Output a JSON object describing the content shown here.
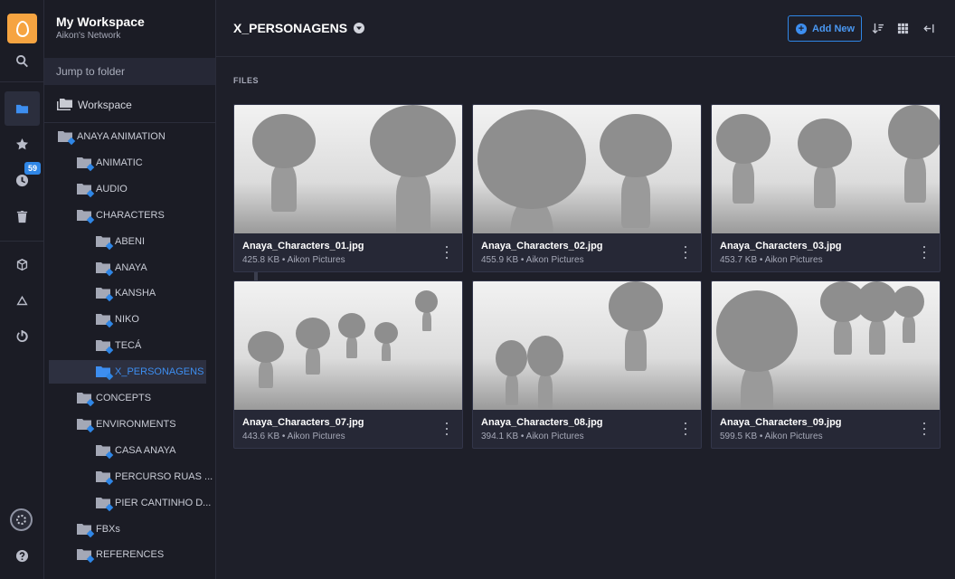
{
  "rail": {
    "badge_count": "59",
    "icons": [
      "logo-icon",
      "search-icon",
      "folder-icon",
      "star-icon",
      "clock-icon",
      "trash-icon",
      "cube-icon",
      "cloud-icon",
      "power-icon",
      "avatar",
      "help-icon"
    ]
  },
  "panel": {
    "title": "My Workspace",
    "subtitle": "Aikon's Network",
    "jump_placeholder": "Jump to folder",
    "workspace_label": "Workspace",
    "tree": [
      {
        "label": "ANAYA ANIMATION",
        "level": 0
      },
      {
        "label": "ANIMATIC",
        "level": 1
      },
      {
        "label": "AUDIO",
        "level": 1
      },
      {
        "label": "CHARACTERS",
        "level": 1
      },
      {
        "label": "ABENI",
        "level": 2
      },
      {
        "label": "ANAYA",
        "level": 2
      },
      {
        "label": "KANSHA",
        "level": 2
      },
      {
        "label": "NIKO",
        "level": 2
      },
      {
        "label": "TECÁ",
        "level": 2
      },
      {
        "label": "X_PERSONAGENS",
        "level": 2,
        "selected": true
      },
      {
        "label": "CONCEPTS",
        "level": 1
      },
      {
        "label": "ENVIRONMENTS",
        "level": 1
      },
      {
        "label": "CASA ANAYA",
        "level": 2
      },
      {
        "label": "PERCURSO RUAS ...",
        "level": 2
      },
      {
        "label": "PIER CANTINHO D...",
        "level": 2
      },
      {
        "label": "FBXs",
        "level": 1
      },
      {
        "label": "REFERENCES",
        "level": 1
      }
    ]
  },
  "header": {
    "title": "X_PERSONAGENS",
    "add_new": "Add New"
  },
  "files_label": "FILES",
  "files": [
    {
      "name": "Anaya_Characters_01.jpg",
      "meta": "425.8 KB • Aikon Pictures"
    },
    {
      "name": "Anaya_Characters_02.jpg",
      "meta": "455.9 KB • Aikon Pictures"
    },
    {
      "name": "Anaya_Characters_03.jpg",
      "meta": "453.7 KB • Aikon Pictures"
    },
    {
      "name": "Anaya_Characters_07.jpg",
      "meta": "443.6 KB • Aikon Pictures"
    },
    {
      "name": "Anaya_Characters_08.jpg",
      "meta": "394.1 KB • Aikon Pictures"
    },
    {
      "name": "Anaya_Characters_09.jpg",
      "meta": "599.5 KB • Aikon Pictures"
    }
  ],
  "colors": {
    "accent": "#2f86e6",
    "brand": "#f6a441",
    "background": "#1e1f29"
  }
}
